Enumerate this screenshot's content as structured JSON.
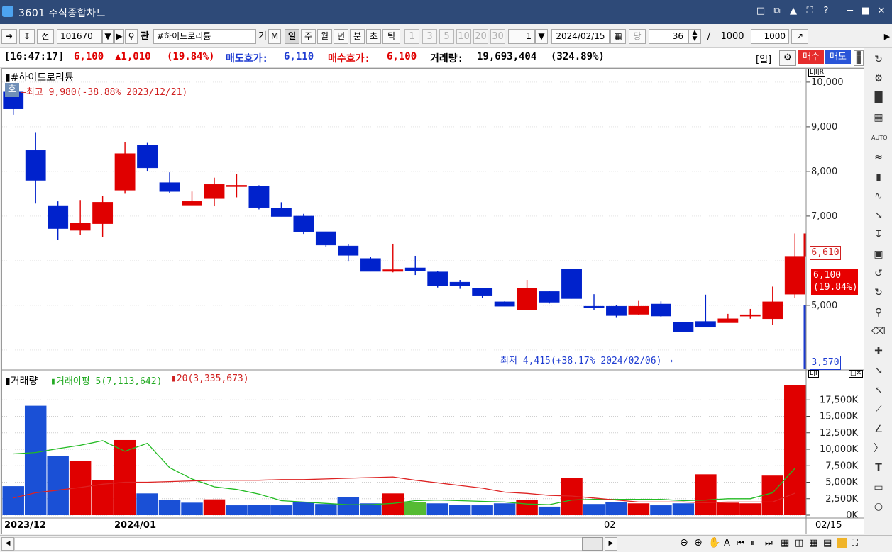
{
  "window": {
    "title": "3601  주식종합차트"
  },
  "toolbar": {
    "code": "101670",
    "fav_label": "관",
    "stock_name": "#하이드로리튬",
    "prefix_label": "전",
    "btn_gi": "기",
    "btn_m": "M",
    "periods": [
      "일",
      "주",
      "월",
      "년",
      "분",
      "초",
      "틱"
    ],
    "minute_options": [
      "1",
      "3",
      "5",
      "10",
      "20",
      "30"
    ],
    "interval_value": "1",
    "date": "2024/02/15",
    "date_btn": "당",
    "count_value": "36",
    "slash": "/",
    "total_count": "1000",
    "range_value": "1000"
  },
  "status": {
    "time": "[16:47:17]",
    "price": "6,100",
    "change": "▲1,010",
    "change_pct": "(19.84%)",
    "ask_label": "매도호가:",
    "ask_value": "6,110",
    "bid_label": "매수호가:",
    "bid_value": "6,100",
    "volume_label": "거래량:",
    "volume_value": "19,693,404",
    "volume_pct": "(324.89%)",
    "period_tag": "[일]",
    "buy_label": "매수",
    "sell_label": "매도"
  },
  "price_panel": {
    "stock_label": "#하이드로리튬",
    "tag_label": "호",
    "high_note": "최고 9,980(-38.88% 2023/12/21)",
    "low_note": "최저 4,415(+38.17% 2024/02/06)",
    "axis_ticks": [
      "10,000",
      "9,000",
      "8,000",
      "7,000",
      "5,000"
    ],
    "marker_high": "6,610",
    "marker_current": "6,100",
    "marker_current_pct": "(19.84%)",
    "marker_low": "3,570"
  },
  "volume_panel": {
    "title": "거래량",
    "ma5_label": "거래이평 5(7,113,642)",
    "ma20_label": "20(3,335,673)",
    "axis_ticks": [
      "17,500K",
      "15,000K",
      "12,500K",
      "10,000K",
      "7,500K",
      "5,000K",
      "2,500K",
      "0K"
    ]
  },
  "x_axis": {
    "labels": [
      "2023/12",
      "2024/01",
      "02"
    ],
    "current_date": "02/15"
  },
  "colors": {
    "up": "#e00000",
    "down": "#0022cc",
    "ma5": "#22bb22",
    "ma20": "#dd2222",
    "titlebar": "#2e4a78"
  },
  "chart_data": [
    {
      "type": "candlestick",
      "title": "#하이드로리튬",
      "ylim": [
        3570,
        10300
      ],
      "candles": [
        {
          "o": 9780,
          "c": 9400,
          "h": 9980,
          "l": 9270
        },
        {
          "o": 8470,
          "c": 7800,
          "h": 8880,
          "l": 7280
        },
        {
          "o": 7220,
          "c": 6720,
          "h": 7330,
          "l": 6460
        },
        {
          "o": 6680,
          "c": 6840,
          "h": 7360,
          "l": 6580
        },
        {
          "o": 6830,
          "c": 7310,
          "h": 7450,
          "l": 6530
        },
        {
          "o": 7580,
          "c": 8400,
          "h": 8660,
          "l": 7500
        },
        {
          "o": 8590,
          "c": 8080,
          "h": 8640,
          "l": 8000
        },
        {
          "o": 7750,
          "c": 7550,
          "h": 7980,
          "l": 7520
        },
        {
          "o": 7230,
          "c": 7330,
          "h": 7550,
          "l": 7230
        },
        {
          "o": 7390,
          "c": 7710,
          "h": 7860,
          "l": 7220
        },
        {
          "o": 7660,
          "c": 7690,
          "h": 7950,
          "l": 7420
        },
        {
          "o": 7670,
          "c": 7190,
          "h": 7690,
          "l": 7150
        },
        {
          "o": 7180,
          "c": 6990,
          "h": 7310,
          "l": 6990
        },
        {
          "o": 7000,
          "c": 6650,
          "h": 7050,
          "l": 6600
        },
        {
          "o": 6650,
          "c": 6350,
          "h": 6650,
          "l": 6310
        },
        {
          "o": 6330,
          "c": 6120,
          "h": 6370,
          "l": 5980
        },
        {
          "o": 6050,
          "c": 5760,
          "h": 6090,
          "l": 5760
        },
        {
          "o": 5760,
          "c": 5800,
          "h": 6380,
          "l": 5740
        },
        {
          "o": 5840,
          "c": 5780,
          "h": 6110,
          "l": 5680
        },
        {
          "o": 5750,
          "c": 5440,
          "h": 5770,
          "l": 5400
        },
        {
          "o": 5520,
          "c": 5440,
          "h": 5570,
          "l": 5370
        },
        {
          "o": 5390,
          "c": 5210,
          "h": 5390,
          "l": 5160
        },
        {
          "o": 5080,
          "c": 4980,
          "h": 5090,
          "l": 4980
        },
        {
          "o": 4900,
          "c": 5390,
          "h": 5570,
          "l": 4890
        },
        {
          "o": 5310,
          "c": 5070,
          "h": 5320,
          "l": 5040
        },
        {
          "o": 5820,
          "c": 5150,
          "h": 5820,
          "l": 5150
        },
        {
          "o": 4980,
          "c": 4960,
          "h": 5250,
          "l": 4900
        },
        {
          "o": 4980,
          "c": 4770,
          "h": 5000,
          "l": 4720
        },
        {
          "o": 4800,
          "c": 4980,
          "h": 5100,
          "l": 4780
        },
        {
          "o": 5030,
          "c": 4760,
          "h": 5090,
          "l": 4730
        },
        {
          "o": 4620,
          "c": 4415,
          "h": 4630,
          "l": 4415
        },
        {
          "o": 4640,
          "c": 4510,
          "h": 5240,
          "l": 4510
        },
        {
          "o": 4610,
          "c": 4700,
          "h": 4810,
          "l": 4610
        },
        {
          "o": 4760,
          "c": 4790,
          "h": 4920,
          "l": 4700
        },
        {
          "o": 4700,
          "c": 5080,
          "h": 5420,
          "l": 4560
        },
        {
          "o": 5250,
          "c": 6100,
          "h": 6610,
          "l": 5160
        }
      ],
      "current_price_range": [
        3570,
        6610
      ]
    },
    {
      "type": "bar",
      "title": "거래량",
      "unit": "K",
      "ylim": [
        0,
        20000
      ],
      "values": [
        4400,
        16600,
        9000,
        8200,
        5300,
        11400,
        3300,
        2300,
        1900,
        2400,
        1500,
        1600,
        1500,
        2000,
        1700,
        2700,
        1800,
        3300,
        2000,
        1800,
        1600,
        1500,
        1800,
        2300,
        1300,
        5600,
        1700,
        2000,
        1800,
        1500,
        1800,
        6200,
        1900,
        1800,
        6000,
        19693
      ],
      "colors": [
        "down",
        "down",
        "down",
        "up",
        "up",
        "up",
        "down",
        "down",
        "down",
        "up",
        "down",
        "down",
        "down",
        "down",
        "down",
        "down",
        "down",
        "up",
        "flat",
        "down",
        "down",
        "down",
        "down",
        "up",
        "down",
        "up",
        "down",
        "down",
        "up",
        "down",
        "down",
        "up",
        "up",
        "up",
        "up",
        "up"
      ],
      "series": [
        {
          "name": "거래이평 5",
          "values": [
            9300,
            9500,
            10100,
            10600,
            11300,
            9700,
            10900,
            7200,
            5500,
            4300,
            3900,
            3200,
            2200,
            2000,
            1800,
            1600,
            1600,
            1800,
            2200,
            2300,
            2200,
            2100,
            2000,
            1700,
            1600,
            2300,
            2400,
            2400,
            2400,
            2400,
            2200,
            2300,
            2500,
            2500,
            3400,
            7113
          ]
        },
        {
          "name": "20",
          "values": [
            2600,
            3400,
            3800,
            4200,
            4700,
            5000,
            5000,
            5100,
            5200,
            5300,
            5300,
            5300,
            5400,
            5400,
            5500,
            5600,
            5700,
            5800,
            5300,
            4900,
            4500,
            4100,
            3500,
            3300,
            3000,
            2900,
            2600,
            2300,
            2000,
            2000,
            2000,
            1900,
            2000,
            2000,
            2000,
            3336
          ]
        }
      ]
    }
  ]
}
